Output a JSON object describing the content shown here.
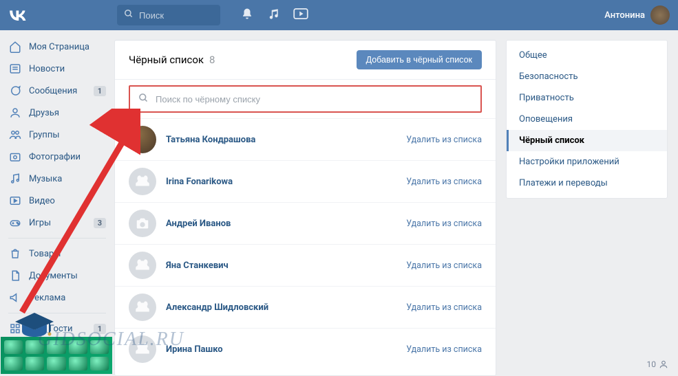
{
  "header": {
    "search_placeholder": "Поиск",
    "user_name": "Антонина"
  },
  "left_menu": {
    "items": [
      {
        "label": "Моя Страница"
      },
      {
        "label": "Новости"
      },
      {
        "label": "Сообщения",
        "badge": "1"
      },
      {
        "label": "Друзья"
      },
      {
        "label": "Группы"
      },
      {
        "label": "Фотографии"
      },
      {
        "label": "Музыка"
      },
      {
        "label": "Видео"
      },
      {
        "label": "Игры",
        "badge": "3"
      }
    ],
    "items2": [
      {
        "label": "Товары"
      },
      {
        "label": "Документы"
      },
      {
        "label": "Реклама"
      }
    ],
    "items3": [
      {
        "label": "Мои Гости",
        "badge": "1"
      }
    ]
  },
  "main": {
    "title": "Чёрный список",
    "count": "8",
    "add_button": "Добавить в чёрный список",
    "search_placeholder": "Поиск по чёрному списку",
    "remove_label": "Удалить из списка",
    "rows": [
      {
        "name": "Татьяна Кондрашова"
      },
      {
        "name": "Irina Fonarikowa"
      },
      {
        "name": "Андрей Иванов"
      },
      {
        "name": "Яна Станкевич"
      },
      {
        "name": "Александр Шидловский"
      },
      {
        "name": "Ирина Пашко"
      }
    ]
  },
  "right_menu": {
    "items": [
      {
        "label": "Общее"
      },
      {
        "label": "Безопасность"
      },
      {
        "label": "Приватность"
      },
      {
        "label": "Оповещения"
      },
      {
        "label": "Чёрный список",
        "active": true
      },
      {
        "label": "Настройки приложений"
      },
      {
        "label": "Платежи и переводы"
      }
    ]
  },
  "watermark": "GIDSOCIAL.RU",
  "bottom_count": "10"
}
